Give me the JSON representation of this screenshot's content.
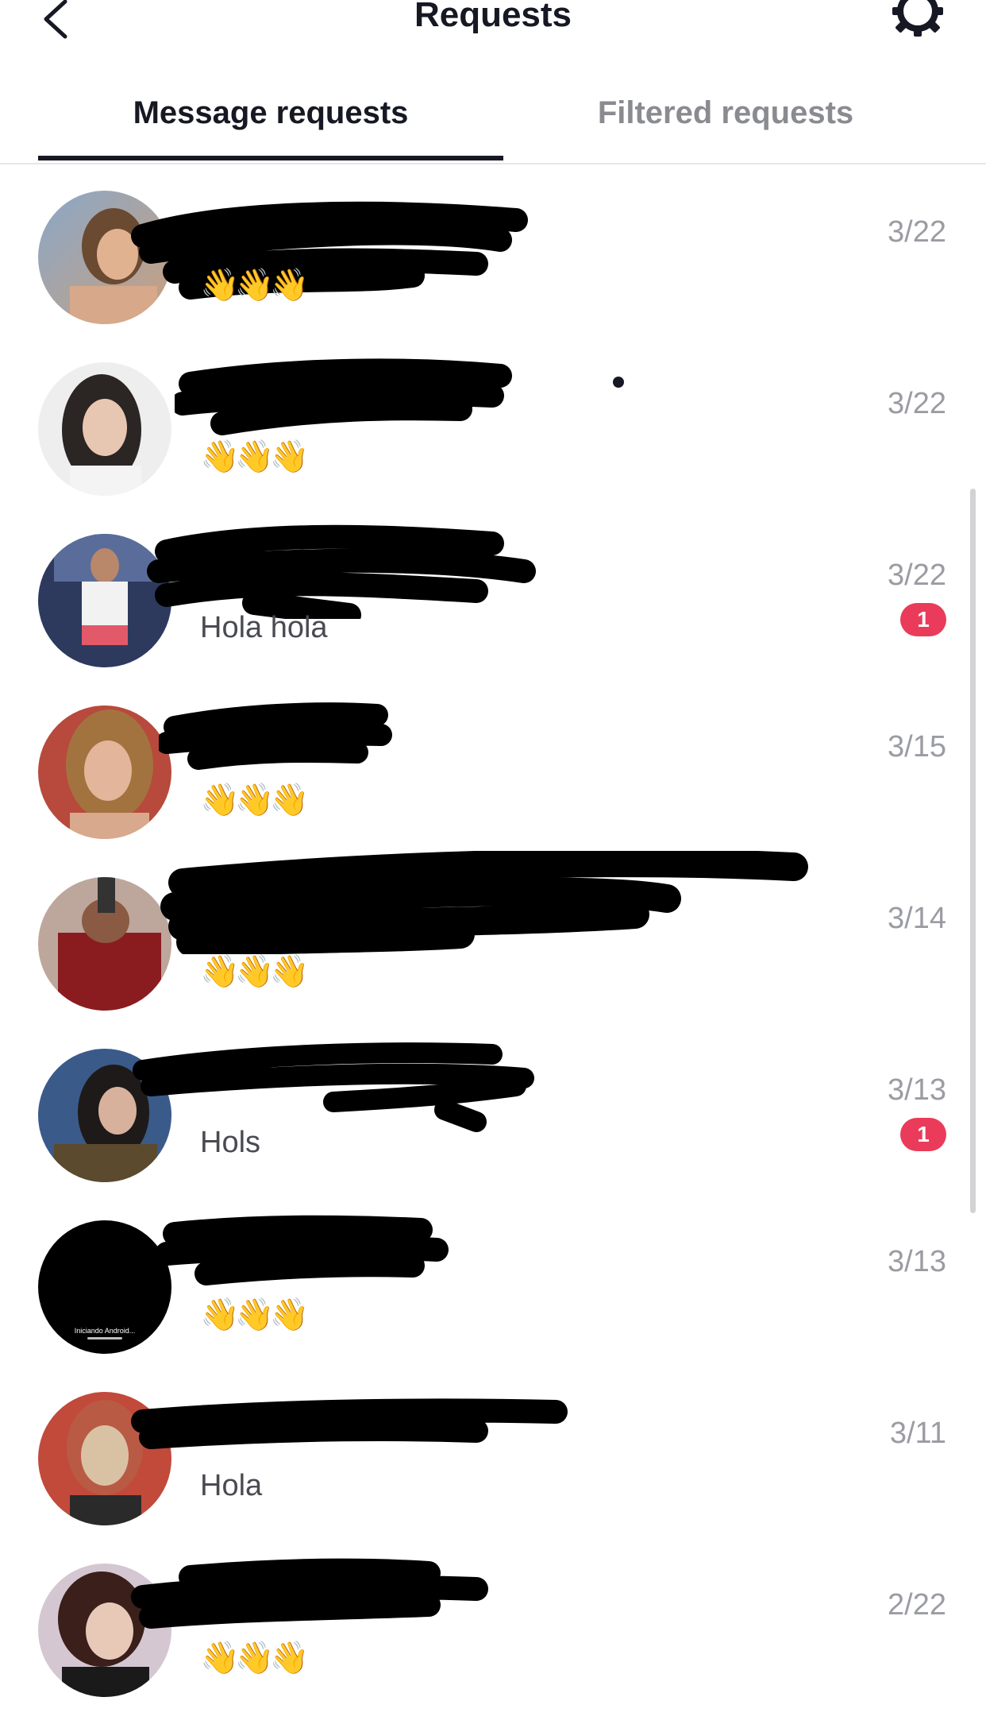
{
  "header": {
    "title": "Requests",
    "back_icon": "chevron-left-icon",
    "settings_icon": "gear-icon"
  },
  "tabs": [
    {
      "label": "Message requests",
      "active": true
    },
    {
      "label": "Filtered requests",
      "active": false
    }
  ],
  "colors": {
    "primary_text": "#161823",
    "secondary_text": "#8a8b91",
    "date_text": "#9b9ca3",
    "badge": "#ea3b5a",
    "divider": "#e6e6e8"
  },
  "requests": [
    {
      "preview": "👋👋👋",
      "date": "3/22",
      "unread": ""
    },
    {
      "preview": "👋👋👋",
      "date": "3/22",
      "unread": ""
    },
    {
      "preview": "Hola hola",
      "date": "3/22",
      "unread": "1"
    },
    {
      "preview": "👋👋👋",
      "date": "3/15",
      "unread": ""
    },
    {
      "preview": "👋👋👋",
      "date": "3/14",
      "unread": ""
    },
    {
      "preview": "Hols",
      "date": "3/13",
      "unread": "1"
    },
    {
      "preview": "👋👋👋",
      "date": "3/13",
      "unread": "",
      "avatar_text": "Iniciando Android..."
    },
    {
      "preview": "Hola",
      "date": "3/11",
      "unread": ""
    },
    {
      "preview": "👋👋👋",
      "date": "2/22",
      "unread": ""
    }
  ]
}
